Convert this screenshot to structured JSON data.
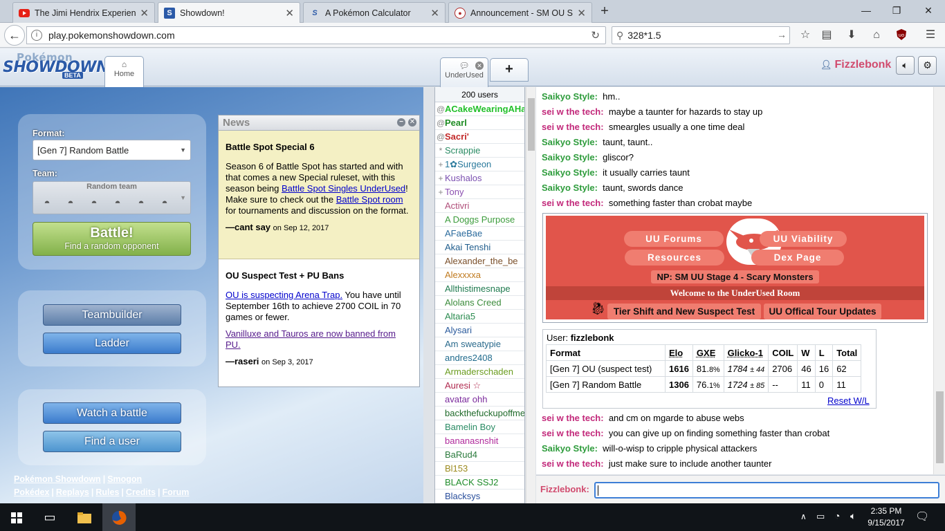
{
  "browser": {
    "tabs": [
      {
        "icon": "youtube-icon",
        "title": "The Jimi Hendrix Experience"
      },
      {
        "icon": "showdown-icon",
        "title": "Showdown!"
      },
      {
        "icon": "showdown-icon",
        "title": "A Pokémon Calculator"
      },
      {
        "icon": "smogon-icon",
        "title": "Announcement - SM OU Su"
      }
    ],
    "url": "play.pokemonshowdown.com",
    "search_value": "328*1.5"
  },
  "ps": {
    "logo_top": "Pokémon",
    "logo_main": "SHOWDOWN!",
    "logo_beta": "BETA",
    "home_tab": "Home",
    "room_tab": "UnderUsed",
    "plus_tab": "+",
    "username": "Fizzlebonk"
  },
  "menu": {
    "format_label": "Format:",
    "format_value": "[Gen 7] Random Battle",
    "team_label": "Team:",
    "team_value": "Random team",
    "battle_title": "Battle!",
    "battle_sub": "Find a random opponent",
    "teambuilder": "Teambuilder",
    "ladder": "Ladder",
    "watch": "Watch a battle",
    "find_user": "Find a user"
  },
  "footer": {
    "row1": [
      "Pokémon Showdown",
      "Smogon"
    ],
    "row2": [
      "Pokédex",
      "Replays",
      "Rules",
      "Credits",
      "Forum"
    ]
  },
  "news": {
    "title": "News",
    "item1": {
      "heading": "Battle Spot Special 6",
      "p1_text1": "Season 6 of Battle Spot has started and with that comes a new Special ruleset, with this season being ",
      "p1_link1": "Battle Spot Singles UnderUsed",
      "p1_text2": "! Make sure to check out the ",
      "p1_link2": "Battle Spot room",
      "p1_text3": " for tournaments and discussion on the format.",
      "author": "—cant say",
      "date": "on Sep 12, 2017"
    },
    "item2": {
      "heading": "OU Suspect Test + PU Bans",
      "p1_link": "OU is suspecting Arena Trap.",
      "p1_text": " You have until September 16th to achieve 2700 COIL in 70 games or fewer.",
      "p2_link": "Vanilluxe and Tauros are now banned from PU.",
      "author": "—raseri",
      "date": "on Sep 3, 2017"
    }
  },
  "userlist": {
    "count": "200 users",
    "users": [
      {
        "group": "@",
        "name": "ACakeWearingAHat",
        "color": "#22c02a",
        "bold": true
      },
      {
        "group": "@",
        "name": "Pearl",
        "color": "#1f8c24",
        "bold": true
      },
      {
        "group": "@",
        "name": "Sacri'",
        "color": "#c22a2a",
        "bold": true
      },
      {
        "group": "*",
        "name": "Scrappie",
        "color": "#2a8b64",
        "bold": false
      },
      {
        "group": "+",
        "name": "1✿Surgeon",
        "color": "#2a7a9c",
        "bold": false
      },
      {
        "group": "+",
        "name": "Kushalos",
        "color": "#7a4fb0",
        "bold": false
      },
      {
        "group": "+",
        "name": "Tony",
        "color": "#8b4fb0",
        "bold": false
      },
      {
        "group": "",
        "name": "Activri",
        "color": "#b04f7a",
        "bold": false
      },
      {
        "group": "",
        "name": "A Doggs Purpose",
        "color": "#3c9c3c",
        "bold": false
      },
      {
        "group": "",
        "name": "AFaeBae",
        "color": "#2a6a9c",
        "bold": false
      },
      {
        "group": "",
        "name": "Akai Tenshi",
        "color": "#1f5c8c",
        "bold": false
      },
      {
        "group": "",
        "name": "Alexander_the_be",
        "color": "#7a4f2a",
        "bold": false
      },
      {
        "group": "",
        "name": "Alexxxxa",
        "color": "#c07a1f",
        "bold": false
      },
      {
        "group": "",
        "name": "Allthistimesnape",
        "color": "#1f7a4f",
        "bold": false
      },
      {
        "group": "",
        "name": "Alolans Creed",
        "color": "#3c8c3c",
        "bold": false
      },
      {
        "group": "",
        "name": "Altaria5",
        "color": "#2a8b4f",
        "bold": false
      },
      {
        "group": "",
        "name": "Alysari",
        "color": "#2a5a9c",
        "bold": false
      },
      {
        "group": "",
        "name": "Am sweatypie",
        "color": "#2a6a8c",
        "bold": false
      },
      {
        "group": "",
        "name": "andres2408",
        "color": "#1f6a8c",
        "bold": false
      },
      {
        "group": "",
        "name": "Armaderschaden",
        "color": "#6a9c1f",
        "bold": false
      },
      {
        "group": "",
        "name": "Auresi ☆",
        "color": "#b02a4f",
        "bold": false
      },
      {
        "group": "",
        "name": "avatar ohh",
        "color": "#7a2a9c",
        "bold": false
      },
      {
        "group": "",
        "name": "backthefuckupoffme",
        "color": "#1f6a2a",
        "bold": false
      },
      {
        "group": "",
        "name": "Bamelin Boy",
        "color": "#2a8b64",
        "bold": false
      },
      {
        "group": "",
        "name": "bananasnshit",
        "color": "#b02a9c",
        "bold": false
      },
      {
        "group": "",
        "name": "BaRud4",
        "color": "#2a7a3c",
        "bold": false
      },
      {
        "group": "",
        "name": "Bl153",
        "color": "#9c8b1f",
        "bold": false
      },
      {
        "group": "",
        "name": "BLACK SSJ2",
        "color": "#1f8c2a",
        "bold": false
      },
      {
        "group": "",
        "name": "Blacksys",
        "color": "#2a4f9c",
        "bold": false
      }
    ]
  },
  "chat": {
    "messages_top": [
      {
        "user": "Saikyo Style:",
        "color": "#2e9c3c",
        "text": "hm.."
      },
      {
        "user": "sei w the tech:",
        "color": "#c2287a",
        "text": "maybe a taunter for hazards to stay up"
      },
      {
        "user": "sei w the tech:",
        "color": "#c2287a",
        "text": "smeargles usually a one time deal"
      },
      {
        "user": "Saikyo Style:",
        "color": "#2e9c3c",
        "text": "taunt, taunt.."
      },
      {
        "user": "Saikyo Style:",
        "color": "#2e9c3c",
        "text": "gliscor?"
      },
      {
        "user": "Saikyo Style:",
        "color": "#2e9c3c",
        "text": "it usually carries taunt"
      },
      {
        "user": "Saikyo Style:",
        "color": "#2e9c3c",
        "text": "taunt, swords dance"
      },
      {
        "user": "sei w the tech:",
        "color": "#c2287a",
        "text": "something faster than crobat maybe"
      }
    ],
    "messages_bottom": [
      {
        "user": "sei w the tech:",
        "color": "#c2287a",
        "text": "and cm on mgarde to abuse webs"
      },
      {
        "user": "sei w the tech:",
        "color": "#c2287a",
        "text": "you can give up on finding something faster than crobat"
      },
      {
        "user": "Saikyo Style:",
        "color": "#2e9c3c",
        "text": "will-o-wisp to cripple physical attackers"
      },
      {
        "user": "sei w the tech:",
        "color": "#c2287a",
        "text": "just make sure to include another taunter"
      }
    ],
    "input_label": "Fizzlebonk:",
    "input_value": ""
  },
  "banner": {
    "uu_forums": "UU Forums",
    "uu_viability": "UU Viability",
    "resources": "Resources",
    "dex_page": "Dex Page",
    "now_playing": "NP: SM UU Stage 4 - Scary Monsters",
    "welcome": "Welcome to the UnderUsed Room",
    "tier_shift": "Tier Shift and New Suspect Test",
    "tour_updates": "UU Offical Tour Updates"
  },
  "stats": {
    "user_label": "User:",
    "user_name": "fizzlebonk",
    "headers": [
      "Format",
      "Elo",
      "GXE",
      "Glicko-1",
      "COIL",
      "W",
      "L",
      "Total"
    ],
    "rows": [
      {
        "format": "[Gen 7] OU (suspect test)",
        "elo": "1616",
        "gxe": "81.",
        "gxe_dec": "8%",
        "glicko": "1784",
        "glicko_dev": "± 44",
        "coil": "2706",
        "w": "46",
        "l": "16",
        "total": "62"
      },
      {
        "format": "[Gen 7] Random Battle",
        "elo": "1306",
        "gxe": "76.",
        "gxe_dec": "1%",
        "glicko": "1724",
        "glicko_dev": "± 85",
        "coil": "--",
        "w": "11",
        "l": "0",
        "total": "11"
      }
    ],
    "reset": "Reset W/L"
  },
  "taskbar": {
    "time": "2:35 PM",
    "date": "9/15/2017"
  }
}
